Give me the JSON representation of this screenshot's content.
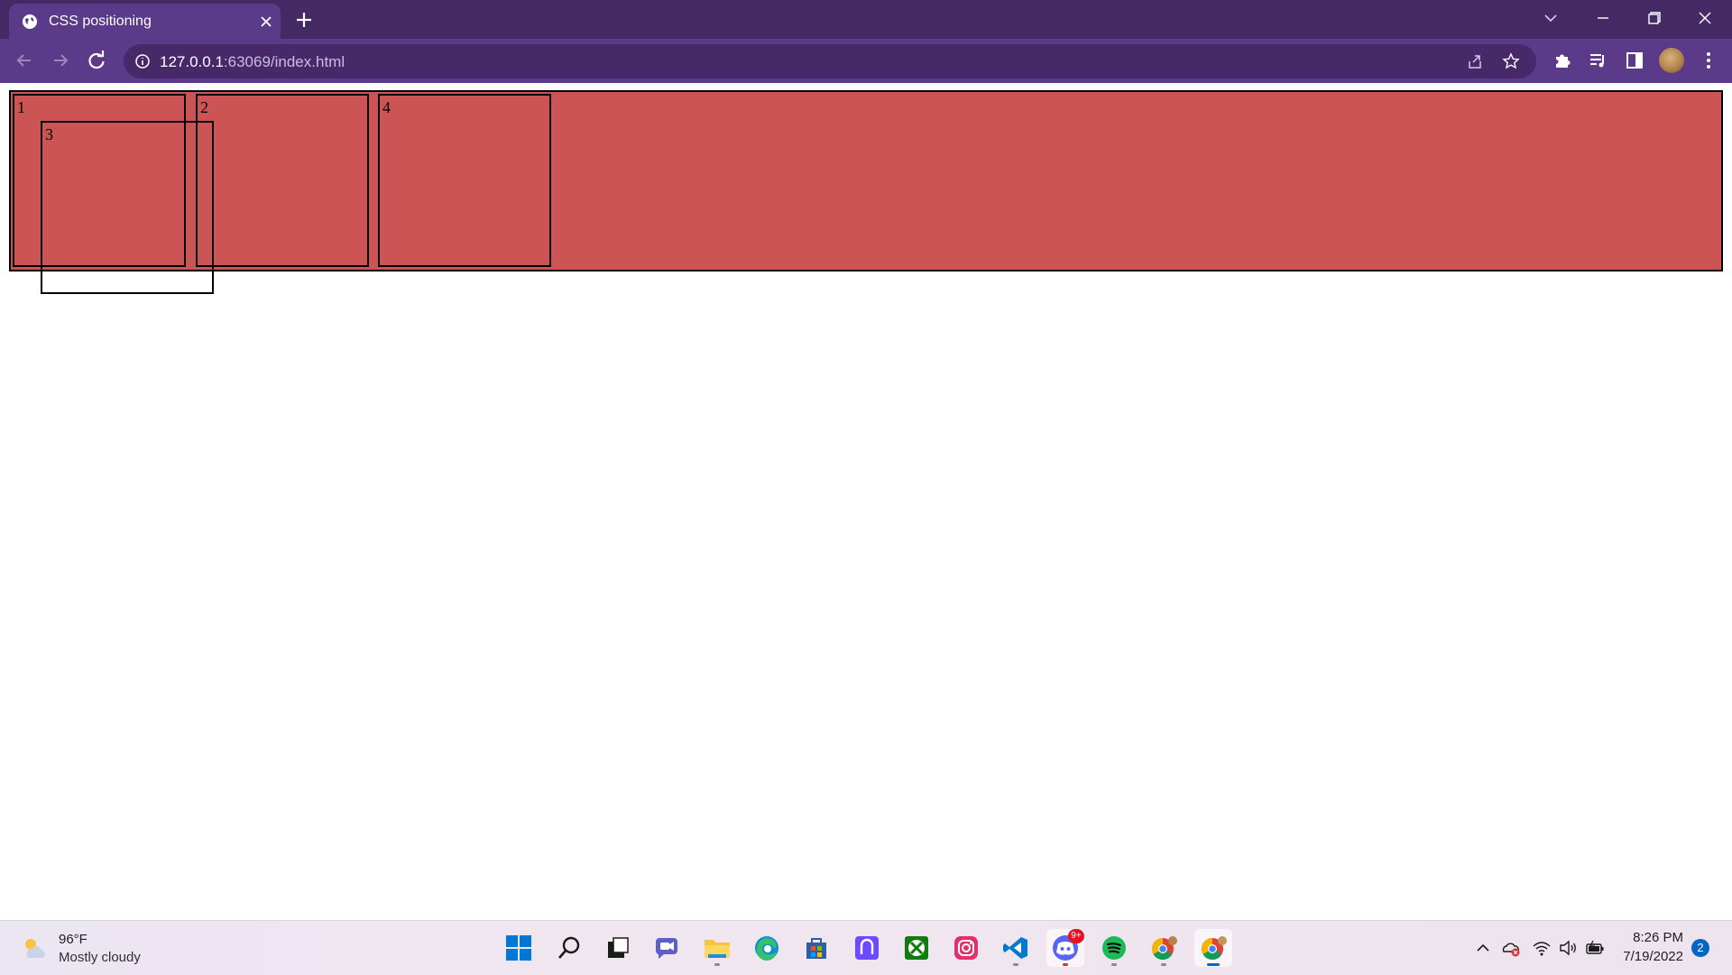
{
  "browser": {
    "tab_title": "CSS positioning",
    "url_host": "127.0.0.1",
    "url_rest": ":63069/index.html"
  },
  "page": {
    "boxes": {
      "box1": "1",
      "box2": "2",
      "box3": "3",
      "box4": "4"
    },
    "colors": {
      "container_bg": "#cd5454",
      "box_border": "#000000"
    }
  },
  "taskbar": {
    "weather_temp": "96°F",
    "weather_condition": "Mostly cloudy",
    "apps": [
      "start-icon",
      "search-icon",
      "task-view-icon",
      "teams-chat-icon",
      "file-explorer-icon",
      "edge-icon",
      "microsoft-store-icon",
      "proton-vpn-icon",
      "xbox-icon",
      "instagram-icon",
      "vscode-icon",
      "discord-icon",
      "spotify-icon",
      "chrome-icon",
      "chrome-active-icon"
    ],
    "discord_badge": "9+",
    "clock_time": "8:26 PM",
    "clock_date": "7/19/2022",
    "notification_count": "2"
  }
}
